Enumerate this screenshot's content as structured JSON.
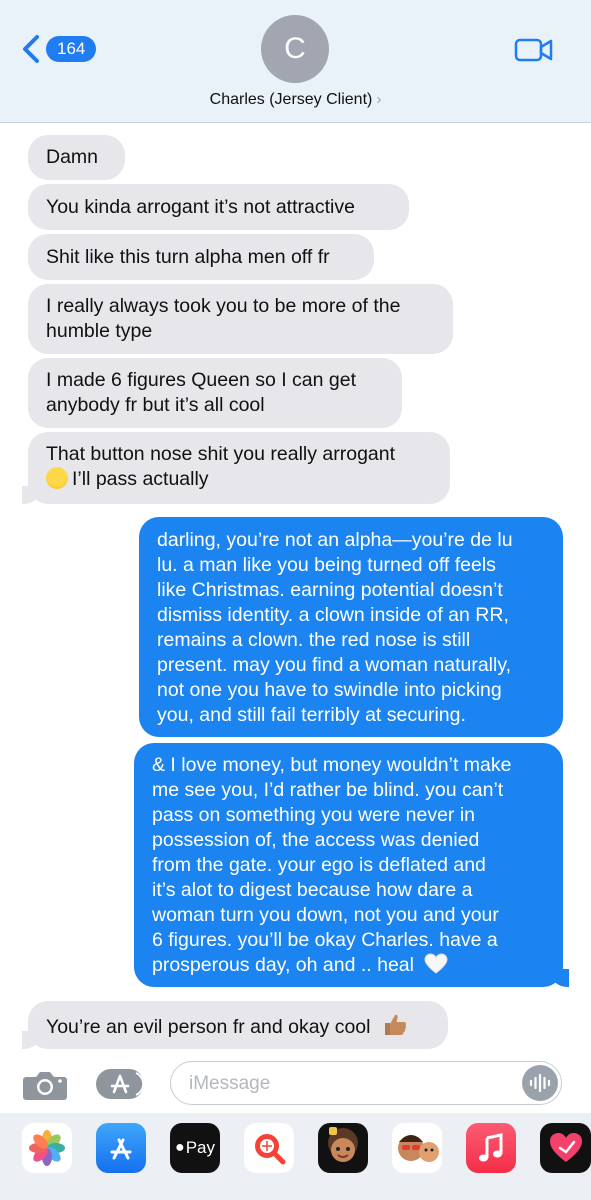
{
  "header": {
    "back_count": "164",
    "avatar_initial": "C",
    "contact_name": "Charles (Jersey Client)",
    "chevron": "›",
    "accent": "#1f7cf2"
  },
  "messages": [
    {
      "from": "them",
      "lines": [
        "Damn"
      ]
    },
    {
      "from": "them",
      "lines": [
        "You kinda arrogant it’s not attractive"
      ]
    },
    {
      "from": "them",
      "lines": [
        "Shit like this turn alpha men off fr"
      ]
    },
    {
      "from": "them",
      "lines": [
        "I really always took you to be more of the",
        "humble type"
      ]
    },
    {
      "from": "them",
      "lines": [
        "I made 6 figures Queen so I can get",
        "anybody fr but it’s all cool"
      ]
    },
    {
      "from": "them",
      "lines": [
        "That button nose shit you really arrogant",
        "I’ll pass actually"
      ],
      "emoji": "laughing-crying-emoji"
    },
    {
      "from": "me",
      "lines": [
        "darling, you’re not an alpha—you’re de lu",
        "lu. a man like you being turned off feels",
        "like Christmas. earning potential doesn’t",
        "dismiss identity. a clown inside of an RR,",
        "remains a clown. the red nose is still",
        "present. may you find a woman naturally,",
        "not one you have to swindle into picking",
        "you, and still fail terribly at securing."
      ]
    },
    {
      "from": "me",
      "lines": [
        "& I love money, but money wouldn’t make",
        "me see you, I’d rather be blind. you can’t",
        "pass on something you were never in",
        "possession of, the access was denied",
        "from the gate. your ego is deflated and",
        "it’s alot to digest because how dare a",
        "woman turn you down, not you and your",
        "6 figures. you’ll be okay Charles. have a",
        "prosperous day, oh and .. heal"
      ],
      "emoji": "white-heart-emoji"
    },
    {
      "from": "them",
      "lines": [
        "You’re an evil person fr and okay cool"
      ],
      "emoji": "thumbs-up-emoji"
    }
  ],
  "composer": {
    "placeholder": "iMessage"
  },
  "drawer": {
    "apple_pay_label": "Pay",
    "apps": [
      "photos-icon",
      "app-store-icon",
      "apple-pay-icon",
      "images-search-icon",
      "memoji-icon",
      "memoji-stickers-icon",
      "music-icon",
      "digital-touch-icon"
    ]
  },
  "colors": {
    "incoming_bubble": "#e6e6eb",
    "outgoing_bubble": "#1b84f0",
    "header_bg": "#e9f1f9"
  }
}
